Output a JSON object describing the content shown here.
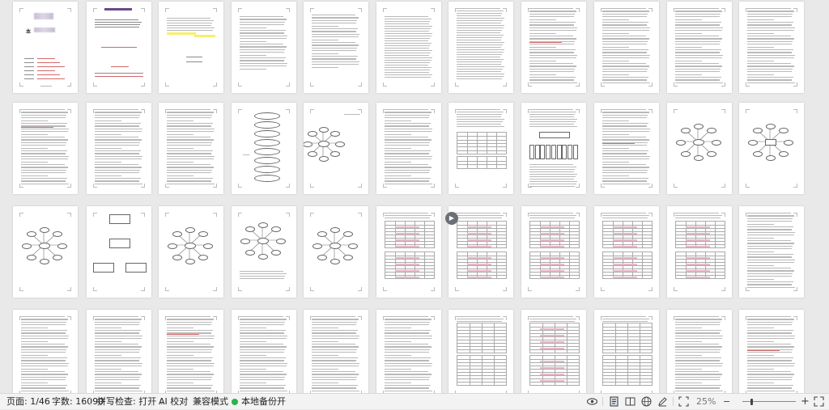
{
  "status_bar": {
    "page_label": "页面: 1/46",
    "word_count_label": "字数: 16090",
    "spellcheck_label": "拼写检查: 打开",
    "ai_proofread_label": "AI 校对",
    "compat_mode_label": "兼容模式",
    "backup_label": "本地备份开",
    "zoom_label": "25%",
    "zoom_out_symbol": "−",
    "zoom_in_symbol": "+"
  },
  "thumbnails": {
    "page_count": 46,
    "columns": 11,
    "visible_rows": 4
  },
  "page1": {
    "title_suffix": "（设计）"
  },
  "page2": {
    "en_title_1": "Design and Implementation of a Quick-",
    "en_title_2": "Search and Styling Sharing Platform"
  },
  "page3": {
    "heading": "学位论文原创性声明"
  },
  "page4": {
    "heading": "摘 要"
  },
  "page5": {
    "heading": "ABSTRACT"
  },
  "page6": {
    "heading": "目 录"
  },
  "diagram_labels": {
    "center_title": "全局 ID",
    "center_node": "数据实体",
    "left_node": "处理数据实体",
    "right_node": "对象实体"
  },
  "colors": {
    "highlight": "#f7f06a",
    "status_green": "#2cb34a",
    "red_text": "#d26a6a"
  }
}
